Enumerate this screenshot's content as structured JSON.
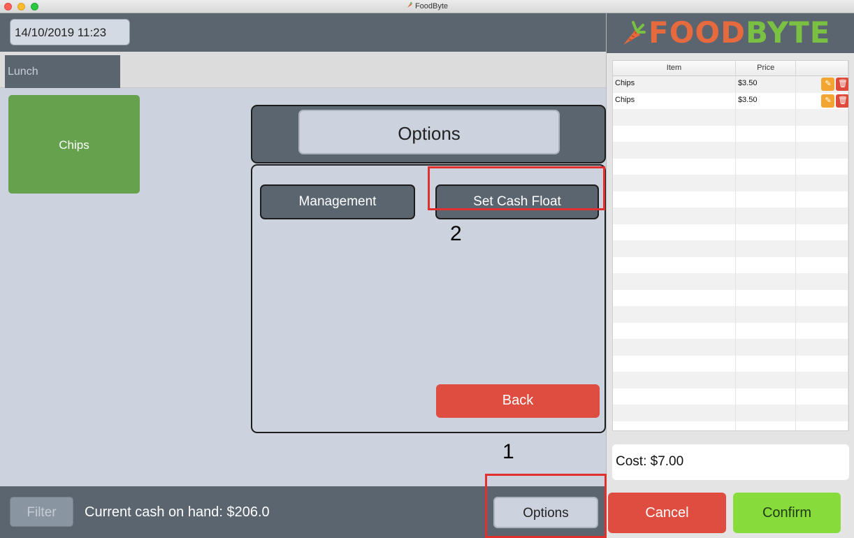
{
  "window": {
    "title": "FoodByte"
  },
  "header": {
    "datetime": "14/10/2019  11:23"
  },
  "tabs": [
    {
      "label": "Lunch"
    }
  ],
  "menu_items": [
    {
      "label": "Chips",
      "color": "#66a24d"
    }
  ],
  "options_dialog": {
    "title": "Options",
    "management_label": "Management",
    "set_cash_float_label": "Set Cash Float",
    "back_label": "Back"
  },
  "annotations": {
    "step1": "1",
    "step2": "2",
    "highlight_color": "#e03030"
  },
  "footer": {
    "filter_label": "Filter",
    "cash_on_hand": "Current cash on hand: $206.0",
    "options_label": "Options"
  },
  "brand": {
    "part1": "FOOD",
    "part2": "BYTE",
    "color1": "#e66a3d",
    "color2": "#7ac143"
  },
  "order_table": {
    "columns": [
      "Item",
      "Price",
      ""
    ],
    "rows": [
      {
        "item": "Chips",
        "price": "$3.50",
        "actions": [
          "pencil-icon",
          "trash-icon"
        ]
      },
      {
        "item": "Chips",
        "price": "$3.50",
        "actions": [
          "pencil-icon",
          "trash-icon"
        ]
      }
    ]
  },
  "cost_label": "Cost: $7.00",
  "cancel_label": "Cancel",
  "confirm_label": "Confirm",
  "colors": {
    "panel": "#5a6570",
    "background": "#ccd3de",
    "danger": "#de4d3f",
    "confirm": "#87dc3b",
    "edit": "#f2a530"
  }
}
